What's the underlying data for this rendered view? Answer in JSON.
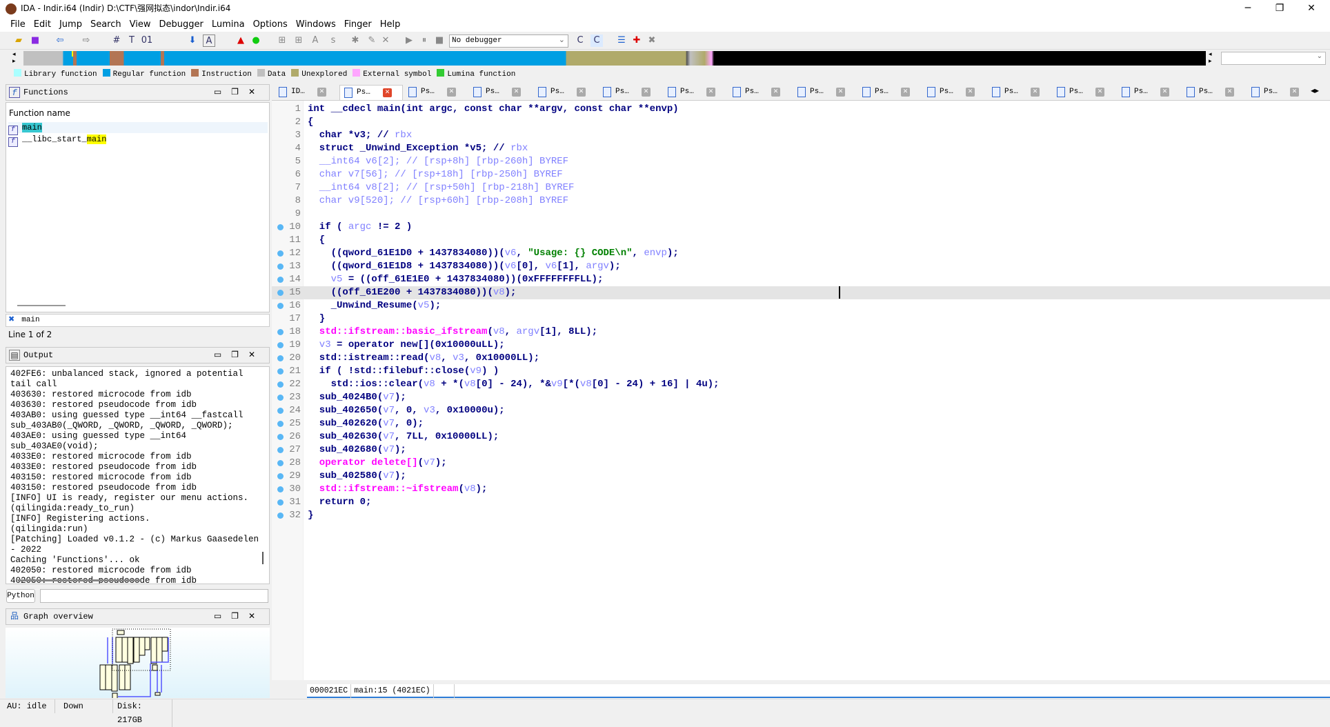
{
  "window": {
    "title": "IDA - Indir.i64 (Indir) D:\\CTF\\强网拟态\\indor\\Indir.i64",
    "minimize": "─",
    "maximize": "❐",
    "close": "✕"
  },
  "menu": [
    "File",
    "Edit",
    "Jump",
    "Search",
    "View",
    "Debugger",
    "Lumina",
    "Options",
    "Windows",
    "Finger",
    "Help"
  ],
  "toolbar": {
    "debugger_select": "No debugger"
  },
  "legend": [
    {
      "label": "Library function",
      "color": "#aaffff"
    },
    {
      "label": "Regular function",
      "color": "#009fe3"
    },
    {
      "label": "Instruction",
      "color": "#b37554"
    },
    {
      "label": "Data",
      "color": "#c0c0c0"
    },
    {
      "label": "Unexplored",
      "color": "#b0aa6a"
    },
    {
      "label": "External symbol",
      "color": "#ffa6ff"
    },
    {
      "label": "Lumina function",
      "color": "#33cc33"
    }
  ],
  "functions_panel": {
    "title": "Functions",
    "column": "Function name",
    "items": [
      {
        "prefix": "",
        "match": "main"
      },
      {
        "prefix": "__libc_start_",
        "match": "main"
      }
    ],
    "filter": "main",
    "status": "Line 1 of 2"
  },
  "output_panel": {
    "title": "Output",
    "lines": [
      "402FE6: unbalanced stack, ignored a potential tail call",
      "403630: restored microcode from idb",
      "403630: restored pseudocode from idb",
      "403AB0: using guessed type __int64 __fastcall sub_403AB0(_QWORD, _QWORD, _QWORD, _QWORD);",
      "403AE0: using guessed type __int64 sub_403AE0(void);",
      "4033E0: restored microcode from idb",
      "4033E0: restored pseudocode from idb",
      "403150: restored microcode from idb",
      "403150: restored pseudocode from idb",
      "[INFO] UI is ready, register our menu actions. (qilingida:ready_to_run)",
      "[INFO] Registering actions.       (qilingida:run)",
      "[Patching] Loaded v0.1.2 - (c) Markus Gaasedelen - 2022",
      "Caching 'Functions'... ok",
      "402050: restored microcode from idb",
      "402050: restored pseudocode from idb"
    ]
  },
  "python_button": "Python",
  "graph_panel": {
    "title": "Graph overview"
  },
  "statusbar": {
    "au": "AU:  idle",
    "direction": "Down",
    "disk": "Disk: 217GB"
  },
  "tabs": [
    {
      "label": "ID…",
      "active": false
    },
    {
      "label": "Ps…",
      "active": true
    },
    {
      "label": "Ps…"
    },
    {
      "label": "Ps…"
    },
    {
      "label": "Ps…"
    },
    {
      "label": "Ps…"
    },
    {
      "label": "Ps…"
    },
    {
      "label": "Ps…"
    },
    {
      "label": "Ps…"
    },
    {
      "label": "Ps…"
    },
    {
      "label": "Ps…"
    },
    {
      "label": "Ps…"
    },
    {
      "label": "Ps…"
    },
    {
      "label": "Ps…"
    },
    {
      "label": "Ps…"
    },
    {
      "label": "Ps…"
    }
  ],
  "code": {
    "current_line": 15,
    "lines": [
      {
        "bp": false,
        "t": [
          [
            "k",
            "int __cdecl main(int argc, const char **argv, const char **envp)"
          ]
        ]
      },
      {
        "bp": false,
        "t": [
          [
            "k",
            "{"
          ]
        ]
      },
      {
        "bp": false,
        "t": [
          [
            "k",
            "  char *v3; // "
          ],
          [
            "c",
            "rbx"
          ]
        ]
      },
      {
        "bp": false,
        "t": [
          [
            "k",
            "  struct _Unwind_Exception *v5; // "
          ],
          [
            "c",
            "rbx"
          ]
        ]
      },
      {
        "bp": false,
        "t": [
          [
            "c",
            "  __int64 v6[2]; // [rsp+8h] [rbp-260h] BYREF"
          ]
        ]
      },
      {
        "bp": false,
        "t": [
          [
            "c",
            "  char v7[56]; // [rsp+18h] [rbp-250h] BYREF"
          ]
        ]
      },
      {
        "bp": false,
        "t": [
          [
            "c",
            "  __int64 v8[2]; // [rsp+50h] [rbp-218h] BYREF"
          ]
        ]
      },
      {
        "bp": false,
        "t": [
          [
            "c",
            "  char v9[520]; // [rsp+60h] [rbp-208h] BYREF"
          ]
        ]
      },
      {
        "bp": false,
        "t": []
      },
      {
        "bp": true,
        "t": [
          [
            "k",
            "  if ( "
          ],
          [
            "v",
            "argc"
          ],
          [
            "k",
            " != 2 )"
          ]
        ]
      },
      {
        "bp": false,
        "t": [
          [
            "k",
            "  {"
          ]
        ]
      },
      {
        "bp": true,
        "t": [
          [
            "k",
            "    ((qword_61E1D0 + 1437834080))("
          ],
          [
            "v",
            "v6"
          ],
          [
            "k",
            ", "
          ],
          [
            "s",
            "\"Usage: {} CODE\\n\""
          ],
          [
            "k",
            ", "
          ],
          [
            "v",
            "envp"
          ],
          [
            "k",
            ");"
          ]
        ]
      },
      {
        "bp": true,
        "t": [
          [
            "k",
            "    ((qword_61E1D8 + 1437834080))("
          ],
          [
            "v",
            "v6"
          ],
          [
            "k",
            "[0], "
          ],
          [
            "v",
            "v6"
          ],
          [
            "k",
            "[1], "
          ],
          [
            "v",
            "argv"
          ],
          [
            "k",
            ");"
          ]
        ]
      },
      {
        "bp": true,
        "t": [
          [
            "v",
            "    v5"
          ],
          [
            "k",
            " = ((off_61E1E0 + 1437834080))(0xFFFFFFFFLL);"
          ]
        ]
      },
      {
        "bp": true,
        "t": [
          [
            "k",
            "    ((off_61E200 + 1437834080))("
          ],
          [
            "v",
            "v8"
          ],
          [
            "k",
            ");"
          ]
        ]
      },
      {
        "bp": true,
        "t": [
          [
            "k",
            "    _Unwind_Resume("
          ],
          [
            "v",
            "v5"
          ],
          [
            "k",
            ");"
          ]
        ]
      },
      {
        "bp": false,
        "t": [
          [
            "k",
            "  }"
          ]
        ]
      },
      {
        "bp": true,
        "t": [
          [
            "m",
            "  std::ifstream::basic_ifstream"
          ],
          [
            "k",
            "("
          ],
          [
            "v",
            "v8"
          ],
          [
            "k",
            ", "
          ],
          [
            "v",
            "argv"
          ],
          [
            "k",
            "[1], 8LL);"
          ]
        ]
      },
      {
        "bp": true,
        "t": [
          [
            "v",
            "  v3"
          ],
          [
            "k",
            " = operator new[](0x10000uLL);"
          ]
        ]
      },
      {
        "bp": true,
        "t": [
          [
            "k",
            "  std::istream::read("
          ],
          [
            "v",
            "v8"
          ],
          [
            "k",
            ", "
          ],
          [
            "v",
            "v3"
          ],
          [
            "k",
            ", 0x10000LL);"
          ]
        ]
      },
      {
        "bp": true,
        "t": [
          [
            "k",
            "  if ( !std::filebuf::close("
          ],
          [
            "v",
            "v9"
          ],
          [
            "k",
            ") )"
          ]
        ]
      },
      {
        "bp": true,
        "t": [
          [
            "k",
            "    std::ios::clear("
          ],
          [
            "v",
            "v8"
          ],
          [
            "k",
            " + *("
          ],
          [
            "v",
            "v8"
          ],
          [
            "k",
            "[0] - 24), *&"
          ],
          [
            "v",
            "v9"
          ],
          [
            "k",
            "[*("
          ],
          [
            "v",
            "v8"
          ],
          [
            "k",
            "[0] - 24) + 16] | 4u);"
          ]
        ]
      },
      {
        "bp": true,
        "t": [
          [
            "k",
            "  sub_4024B0("
          ],
          [
            "v",
            "v7"
          ],
          [
            "k",
            ");"
          ]
        ]
      },
      {
        "bp": true,
        "t": [
          [
            "k",
            "  sub_402650("
          ],
          [
            "v",
            "v7"
          ],
          [
            "k",
            ", 0, "
          ],
          [
            "v",
            "v3"
          ],
          [
            "k",
            ", 0x10000u);"
          ]
        ]
      },
      {
        "bp": true,
        "t": [
          [
            "k",
            "  sub_402620("
          ],
          [
            "v",
            "v7"
          ],
          [
            "k",
            ", 0);"
          ]
        ]
      },
      {
        "bp": true,
        "t": [
          [
            "k",
            "  sub_402630("
          ],
          [
            "v",
            "v7"
          ],
          [
            "k",
            ", 7LL, 0x10000LL);"
          ]
        ]
      },
      {
        "bp": true,
        "t": [
          [
            "k",
            "  sub_402680("
          ],
          [
            "v",
            "v7"
          ],
          [
            "k",
            ");"
          ]
        ]
      },
      {
        "bp": true,
        "t": [
          [
            "m",
            "  operator delete[]"
          ],
          [
            "k",
            "("
          ],
          [
            "v",
            "v7"
          ],
          [
            "k",
            ");"
          ]
        ]
      },
      {
        "bp": true,
        "t": [
          [
            "k",
            "  sub_402580("
          ],
          [
            "v",
            "v7"
          ],
          [
            "k",
            ");"
          ]
        ]
      },
      {
        "bp": true,
        "t": [
          [
            "m",
            "  std::ifstream::~ifstream"
          ],
          [
            "k",
            "("
          ],
          [
            "v",
            "v8"
          ],
          [
            "k",
            ");"
          ]
        ]
      },
      {
        "bp": true,
        "t": [
          [
            "k",
            "  return 0;"
          ]
        ]
      },
      {
        "bp": true,
        "t": [
          [
            "k",
            "}"
          ]
        ]
      }
    ]
  },
  "code_status": {
    "offset": "000021EC",
    "location": "main:15 (4021EC)"
  }
}
